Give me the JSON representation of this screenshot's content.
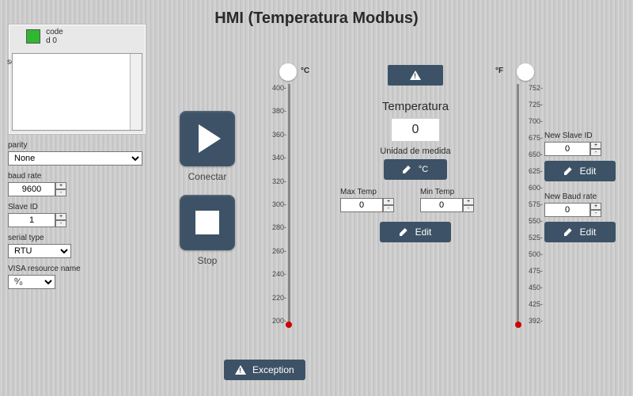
{
  "title": "HMI (Temperatura Modbus)",
  "source": {
    "label": "source",
    "code_label": "code",
    "code_value": "d 0"
  },
  "config": {
    "parity": {
      "label": "parity",
      "value": "None"
    },
    "baud": {
      "label": "baud rate",
      "value": "9600"
    },
    "slave": {
      "label": "Slave ID",
      "value": "1"
    },
    "serial": {
      "label": "serial type",
      "value": "RTU"
    },
    "visa": {
      "label": "VISA resource name",
      "value": "⁰⁄₀"
    }
  },
  "buttons": {
    "connect": "Conectar",
    "stop": "Stop",
    "exception": "Exception"
  },
  "thermo_c": {
    "unit": "°C",
    "ticks": [
      "400",
      "380",
      "360",
      "340",
      "320",
      "300",
      "280",
      "260",
      "240",
      "220",
      "200"
    ]
  },
  "thermo_f": {
    "unit": "°F",
    "ticks": [
      "752",
      "725",
      "700",
      "675",
      "650",
      "625",
      "600",
      "575",
      "550",
      "525",
      "500",
      "475",
      "450",
      "425",
      "392"
    ]
  },
  "temp": {
    "label": "Temperatura",
    "value": "0",
    "unit_label": "Unidad de medida",
    "unit_value": "°C",
    "max_label": "Max Temp",
    "max_value": "0",
    "min_label": "Min Temp",
    "min_value": "0",
    "edit": "Edit"
  },
  "right": {
    "new_slave_label": "New Slave ID",
    "new_slave_value": "0",
    "new_baud_label": "New Baud rate",
    "new_baud_value": "0",
    "edit": "Edit"
  }
}
